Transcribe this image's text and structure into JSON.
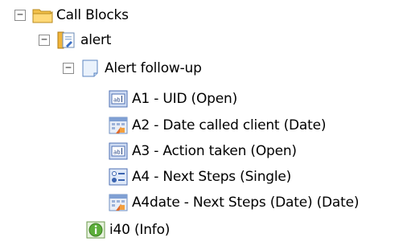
{
  "tree": {
    "root": {
      "label": "Call Blocks",
      "toggle": "−",
      "icon": "folder-icon"
    },
    "alert": {
      "label": "alert",
      "toggle": "−",
      "icon": "script-document-icon"
    },
    "followup": {
      "label": "Alert follow-up",
      "toggle": "−",
      "icon": "page-icon"
    },
    "items": [
      {
        "label": "A1 - UID (Open)",
        "icon": "text-field-icon"
      },
      {
        "label": "A2 - Date called client (Date)",
        "icon": "date-field-icon"
      },
      {
        "label": "A3 - Action taken (Open)",
        "icon": "text-field-icon"
      },
      {
        "label": "A4 - Next Steps (Single)",
        "icon": "single-choice-icon"
      },
      {
        "label": "A4date - Next Steps (Date) (Date)",
        "icon": "date-field-icon"
      }
    ],
    "info": {
      "label": "i40 (Info)",
      "icon": "info-icon"
    }
  }
}
